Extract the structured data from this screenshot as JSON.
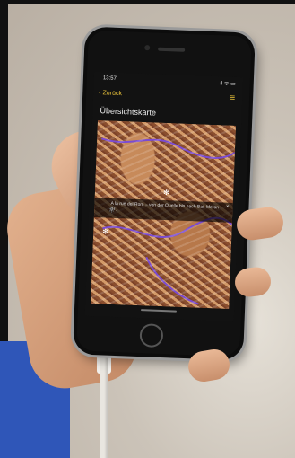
{
  "status": {
    "time": "13:57",
    "icons": "ıl ᯤ ▭"
  },
  "nav": {
    "back_label": "Zurück",
    "menu_icon": "hamburger-icon"
  },
  "page": {
    "title": "Übersichtskarte"
  },
  "info": {
    "text": "A la rue del Rom – von der Quelle bis nach Bai, Meran (IT)",
    "close": "×"
  },
  "colors": {
    "accent": "#e9c23a",
    "route": "#7a4bd1"
  }
}
